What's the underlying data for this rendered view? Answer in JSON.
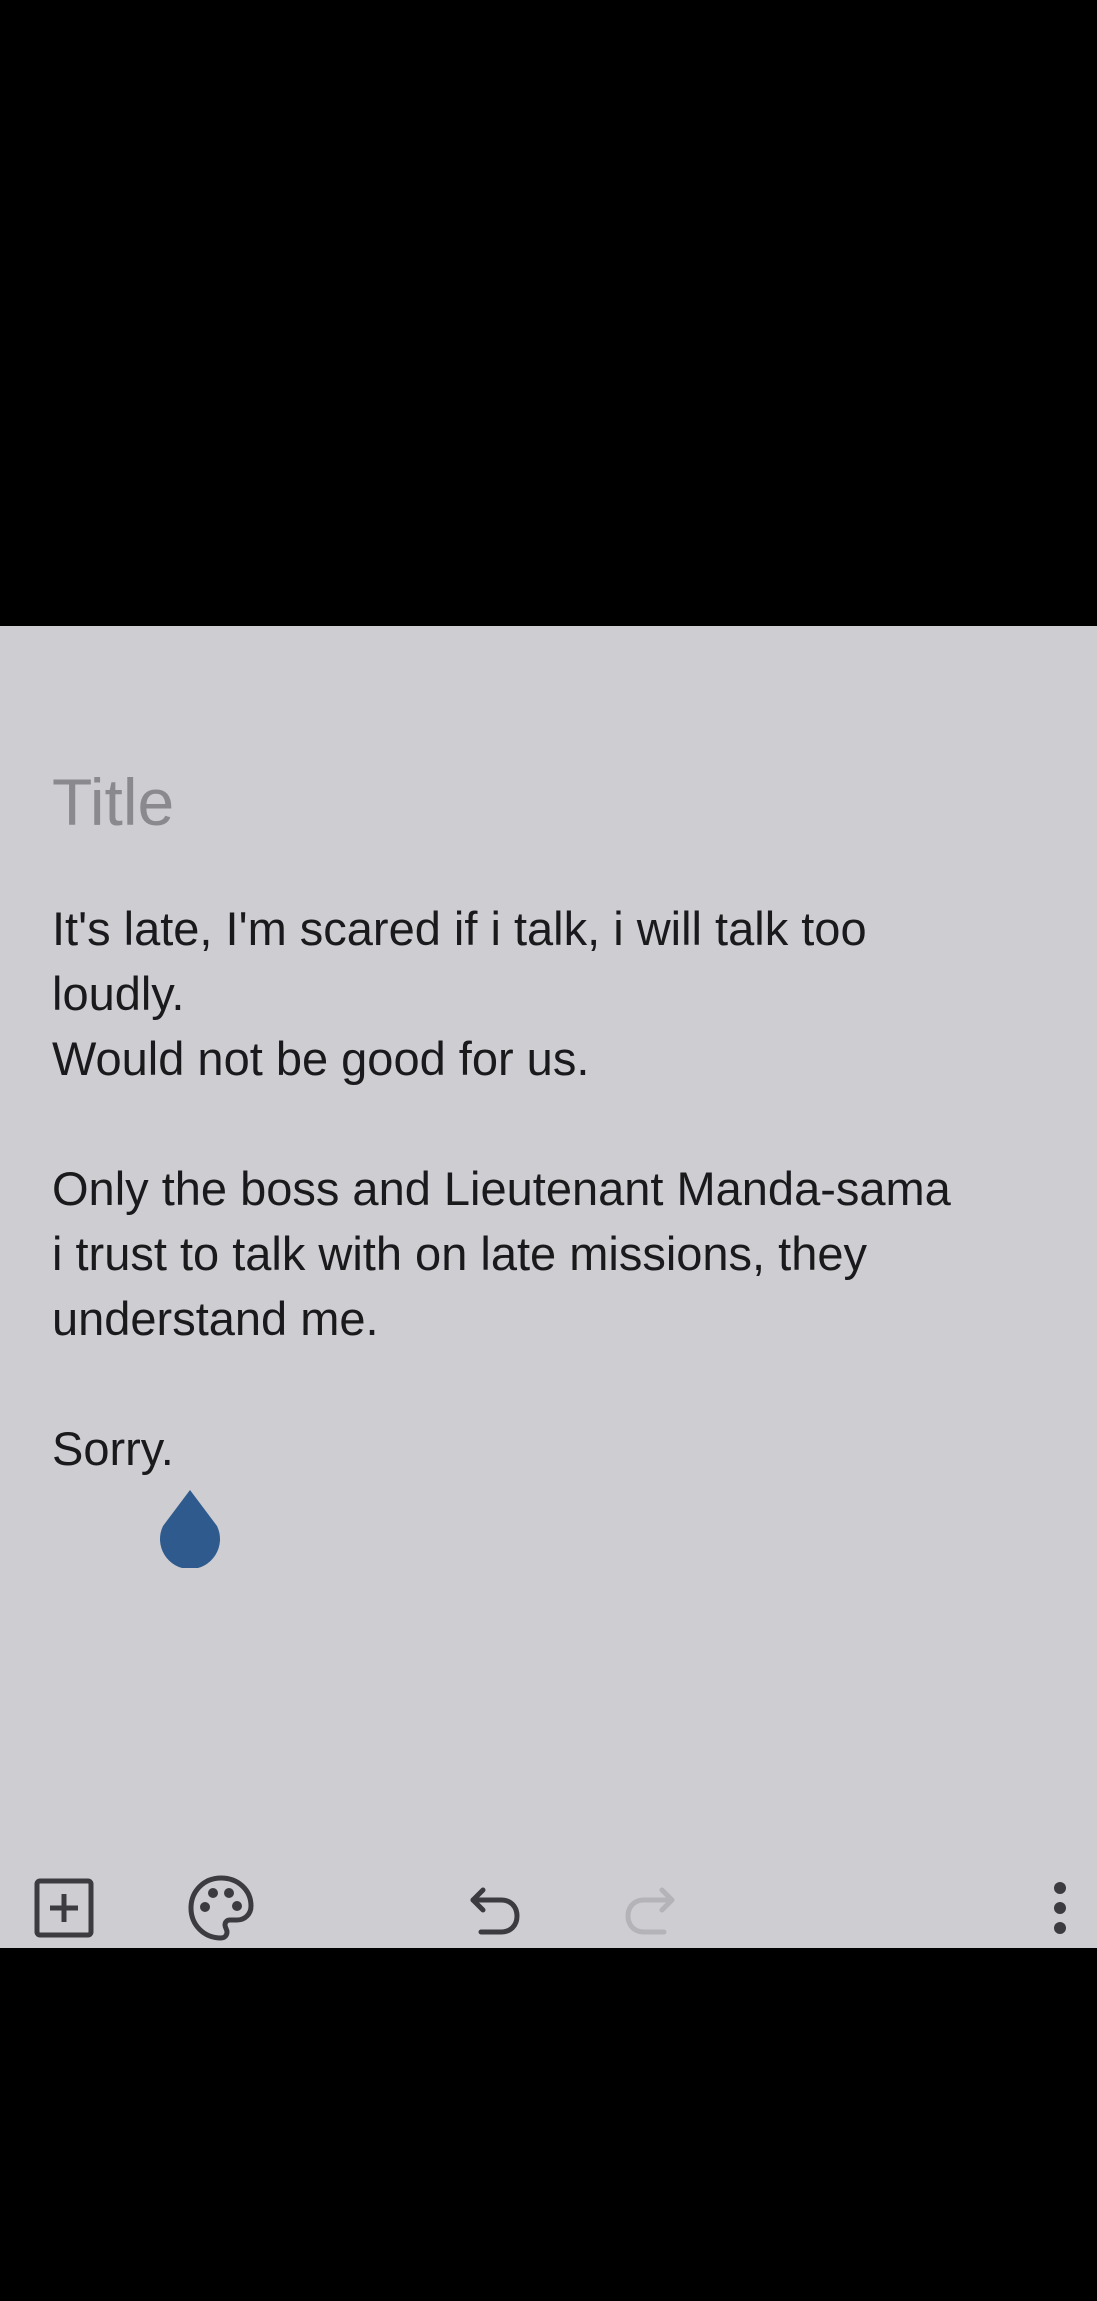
{
  "note": {
    "title_placeholder": "Title",
    "body_lines": [
      "It's late, I'm scared if i talk, i will talk too",
      "loudly.",
      "Would not be good for us.",
      "",
      "Only the boss and Lieutenant Manda-sama",
      "i trust to talk with on late missions, they",
      "understand me.",
      "",
      "Sorry."
    ]
  },
  "toolbar": {
    "add_icon": "add-box-icon",
    "palette_icon": "palette-icon",
    "undo_icon": "undo-icon",
    "redo_icon": "redo-icon",
    "more_icon": "more-vert-icon",
    "redo_enabled": false
  },
  "colors": {
    "sheet_background": "#CDCDD2",
    "text": "#1A1A1C",
    "placeholder": "#8A8A8E",
    "cursor_handle": "#2E5A8E",
    "icon": "#3C3C40",
    "icon_disabled": "#B4B4B8"
  }
}
